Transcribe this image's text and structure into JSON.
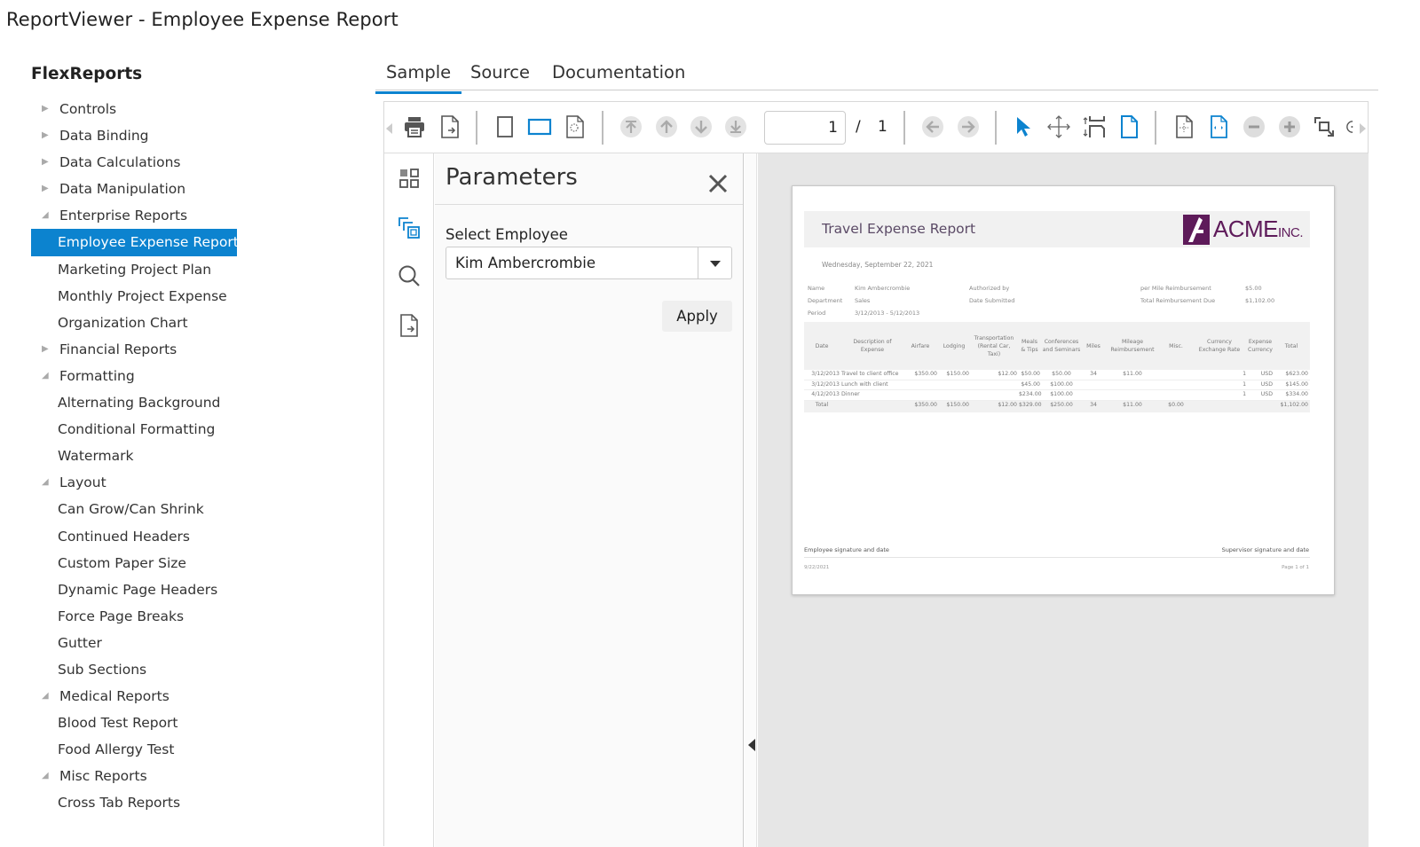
{
  "app": {
    "title": "ReportViewer - Employee Expense Report"
  },
  "sidebar": {
    "title": "FlexReports",
    "items": [
      {
        "label": "Controls",
        "type": "parent",
        "expanded": false
      },
      {
        "label": "Data Binding",
        "type": "parent",
        "expanded": false
      },
      {
        "label": "Data Calculations",
        "type": "parent",
        "expanded": false
      },
      {
        "label": "Data Manipulation",
        "type": "parent",
        "expanded": false
      },
      {
        "label": "Enterprise Reports",
        "type": "parent",
        "expanded": true
      },
      {
        "label": "Employee Expense Report",
        "type": "child",
        "selected": true
      },
      {
        "label": "Marketing Project Plan",
        "type": "child"
      },
      {
        "label": "Monthly Project Expense",
        "type": "child"
      },
      {
        "label": "Organization Chart",
        "type": "child"
      },
      {
        "label": "Financial Reports",
        "type": "parent",
        "expanded": false
      },
      {
        "label": "Formatting",
        "type": "parent",
        "expanded": true
      },
      {
        "label": "Alternating Background",
        "type": "child"
      },
      {
        "label": "Conditional Formatting",
        "type": "child"
      },
      {
        "label": "Watermark",
        "type": "child"
      },
      {
        "label": "Layout",
        "type": "parent",
        "expanded": true
      },
      {
        "label": "Can Grow/Can Shrink",
        "type": "child"
      },
      {
        "label": "Continued Headers",
        "type": "child"
      },
      {
        "label": "Custom Paper Size",
        "type": "child"
      },
      {
        "label": "Dynamic Page Headers",
        "type": "child"
      },
      {
        "label": "Force Page Breaks",
        "type": "child"
      },
      {
        "label": "Gutter",
        "type": "child"
      },
      {
        "label": "Sub Sections",
        "type": "child"
      },
      {
        "label": "Medical Reports",
        "type": "parent",
        "expanded": true
      },
      {
        "label": "Blood Test Report",
        "type": "child"
      },
      {
        "label": "Food Allergy Test",
        "type": "child"
      },
      {
        "label": "Misc Reports",
        "type": "parent",
        "expanded": true
      },
      {
        "label": "Cross Tab Reports",
        "type": "child"
      }
    ]
  },
  "tabs": [
    {
      "label": "Sample",
      "active": true
    },
    {
      "label": "Source",
      "active": false
    },
    {
      "label": "Documentation",
      "active": false
    }
  ],
  "toolbar": {
    "current_page": "1",
    "page_separator": "/",
    "total_pages": "1",
    "accent_color": "#0c83cf"
  },
  "parameters": {
    "title": "Parameters",
    "field_label": "Select Employee",
    "selected_employee": "Kim Ambercrombie",
    "apply_label": "Apply"
  },
  "report": {
    "title": "Travel Expense Report",
    "logo_text": "ACME",
    "logo_suffix": "INC.",
    "brand_color": "#5e1b5a",
    "date": "Wednesday, September 22, 2021",
    "info": {
      "name_label": "Name",
      "name_value": "Kim Ambercrombie",
      "department_label": "Department",
      "department_value": "Sales",
      "period_label": "Period",
      "period_value": "3/12/2013 - 5/12/2013",
      "authorized_label": "Authorized by",
      "submitted_label": "Date Submitted",
      "per_mile_label": "per Mile Reimbursement",
      "per_mile_value": "$5.00",
      "total_due_label": "Total Reimbursement Due",
      "total_due_value": "$1,102.00"
    },
    "columns": [
      "Date",
      "Description of Expense",
      "Airfare",
      "Lodging",
      "Transportation (Rental Car, Taxi)",
      "Meals & Tips",
      "Conferences and Seminars",
      "Miles",
      "Mileage Reimbursement",
      "Misc.",
      "Currency Exchange Rate",
      "Expense Currency",
      "Total"
    ],
    "rows": [
      [
        "3/12/2013",
        "Travel to client office",
        "$350.00",
        "$150.00",
        "$12.00",
        "$50.00",
        "$50.00",
        "34",
        "$11.00",
        "",
        "1",
        "USD",
        "$623.00"
      ],
      [
        "3/12/2013",
        "Lunch with client",
        "",
        "",
        "",
        "$45.00",
        "$100.00",
        "",
        "",
        "",
        "1",
        "USD",
        "$145.00"
      ],
      [
        "4/12/2013",
        "Dinner",
        "",
        "",
        "",
        "$234.00",
        "$100.00",
        "",
        "",
        "",
        "1",
        "USD",
        "$334.00"
      ]
    ],
    "total_row": [
      "Total",
      "",
      "$350.00",
      "$150.00",
      "$12.00",
      "$329.00",
      "$250.00",
      "34",
      "$11.00",
      "$0.00",
      "",
      "",
      "$1,102.00"
    ],
    "employee_signature": "Employee signature and date",
    "supervisor_signature": "Supervisor signature and date",
    "footer_date": "9/22/2021",
    "footer_page": "Page 1 of 1"
  }
}
